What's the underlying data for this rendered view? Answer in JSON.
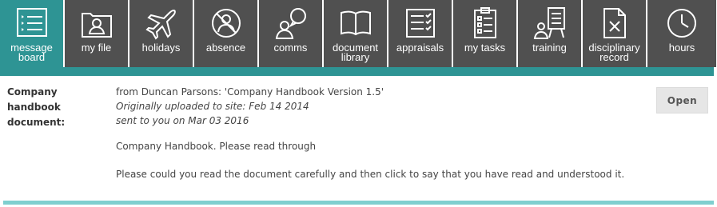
{
  "nav": {
    "items": [
      {
        "label1": "message",
        "label2": "board",
        "icon": "list-icon"
      },
      {
        "label1": "my file",
        "label2": "",
        "icon": "user-folder-icon"
      },
      {
        "label1": "holidays",
        "label2": "",
        "icon": "airplane-icon"
      },
      {
        "label1": "absence",
        "label2": "",
        "icon": "no-person-icon"
      },
      {
        "label1": "comms",
        "label2": "",
        "icon": "chat-person-icon"
      },
      {
        "label1": "document",
        "label2": "library",
        "icon": "open-book-icon"
      },
      {
        "label1": "appraisals",
        "label2": "",
        "icon": "checklist-icon"
      },
      {
        "label1": "my tasks",
        "label2": "",
        "icon": "clipboard-icon"
      },
      {
        "label1": "training",
        "label2": "",
        "icon": "presenter-icon"
      },
      {
        "label1": "disciplinary",
        "label2": "record",
        "icon": "x-document-icon"
      },
      {
        "label1": "hours",
        "label2": "",
        "icon": "clock-icon"
      }
    ]
  },
  "message": {
    "label": "Company handbook document:",
    "from_line": "from Duncan Parsons: 'Company Handbook Version 1.5'",
    "uploaded_line": "Originally uploaded to site: Feb 14 2014",
    "sent_line": "sent to you on Mar 03 2016",
    "subject_line": "Company Handbook. Please read through",
    "body_line": "Please could you read the document carefully and then click to say that you have read and understood it.",
    "open_label": "Open"
  },
  "colors": {
    "active": "#2e9494",
    "tile": "#505050",
    "bottom_bar": "#7fcfcf"
  }
}
